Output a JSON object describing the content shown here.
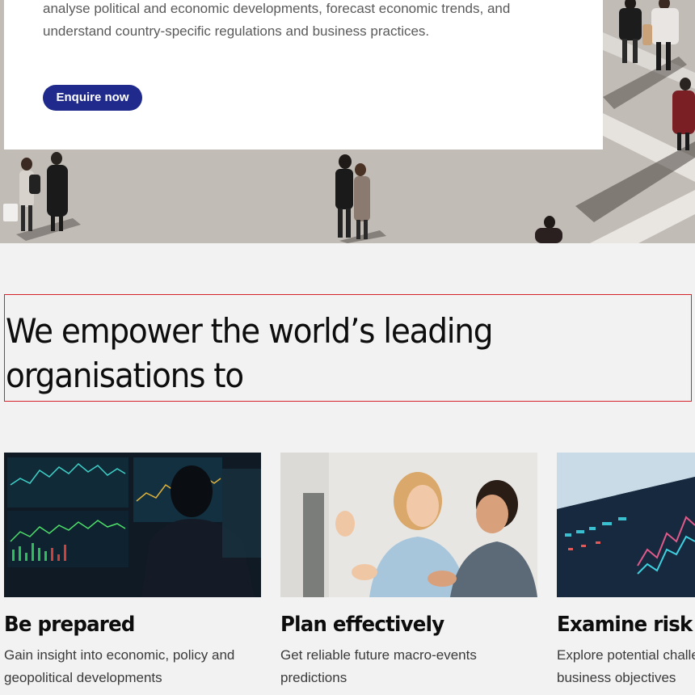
{
  "hero": {
    "description": "analyse political and economic developments, forecast economic trends, and understand country-specific regulations and business practices.",
    "cta_label": "Enquire now"
  },
  "section": {
    "heading": "We empower the world’s leading organisations to"
  },
  "cards": [
    {
      "title": "Be prepared",
      "description": "Gain insight into economic, policy and geopolitical developments"
    },
    {
      "title": "Plan effectively",
      "description": "Get reliable future macro-events predictions"
    },
    {
      "title": "Examine risk",
      "description": "Explore potential challenges to your business objectives"
    }
  ],
  "colors": {
    "cta_background": "#1f2a8c",
    "page_background": "#f2f2f2",
    "highlight_border": "#d4232b"
  }
}
